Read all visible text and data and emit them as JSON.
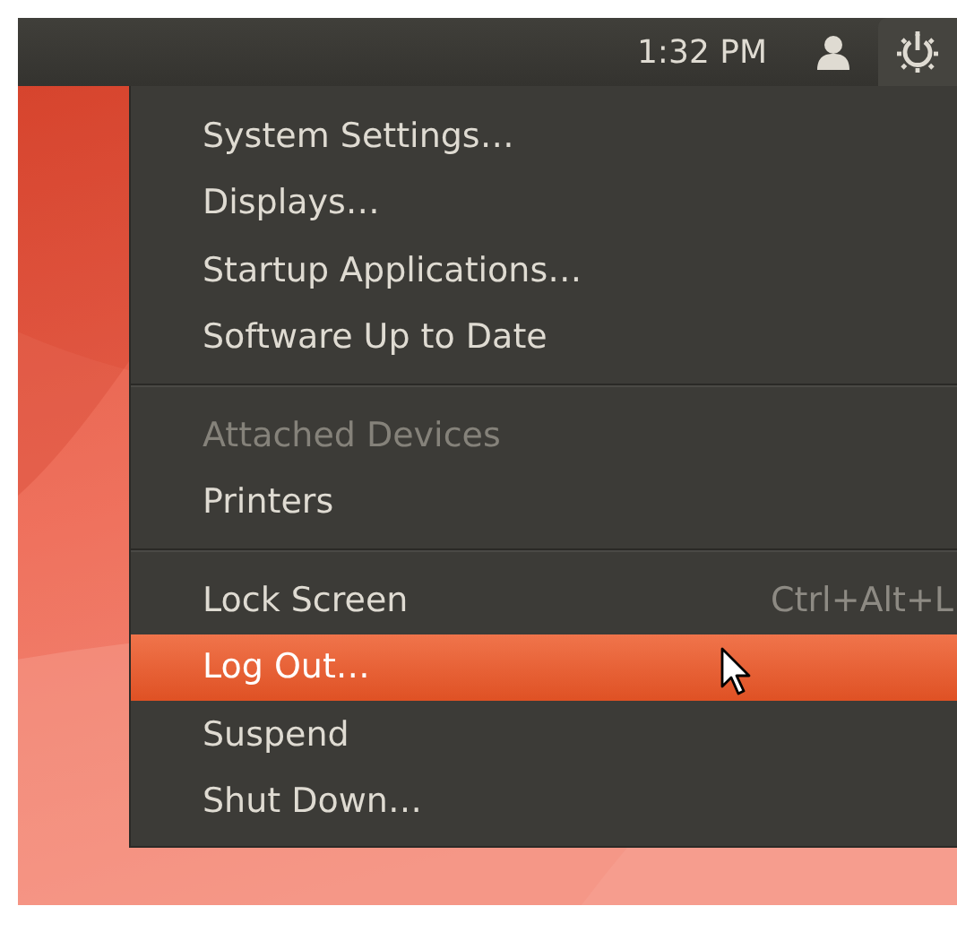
{
  "panel": {
    "clock": "1:32 PM"
  },
  "menu": {
    "sections": [
      {
        "items": [
          {
            "label": "System Settings…",
            "disabled": false,
            "selected": false
          },
          {
            "label": "Displays…",
            "disabled": false,
            "selected": false
          },
          {
            "label": "Startup Applications…",
            "disabled": false,
            "selected": false
          },
          {
            "label": "Software Up to Date",
            "disabled": false,
            "selected": false
          }
        ]
      },
      {
        "items": [
          {
            "label": "Attached Devices",
            "disabled": true,
            "selected": false
          },
          {
            "label": "Printers",
            "disabled": false,
            "selected": false
          }
        ]
      },
      {
        "items": [
          {
            "label": "Lock Screen",
            "shortcut": "Ctrl+Alt+L",
            "disabled": false,
            "selected": false
          },
          {
            "label": "Log Out…",
            "disabled": false,
            "selected": true
          },
          {
            "label": "Suspend",
            "disabled": false,
            "selected": false
          },
          {
            "label": "Shut Down…",
            "disabled": false,
            "selected": false
          }
        ]
      }
    ]
  }
}
